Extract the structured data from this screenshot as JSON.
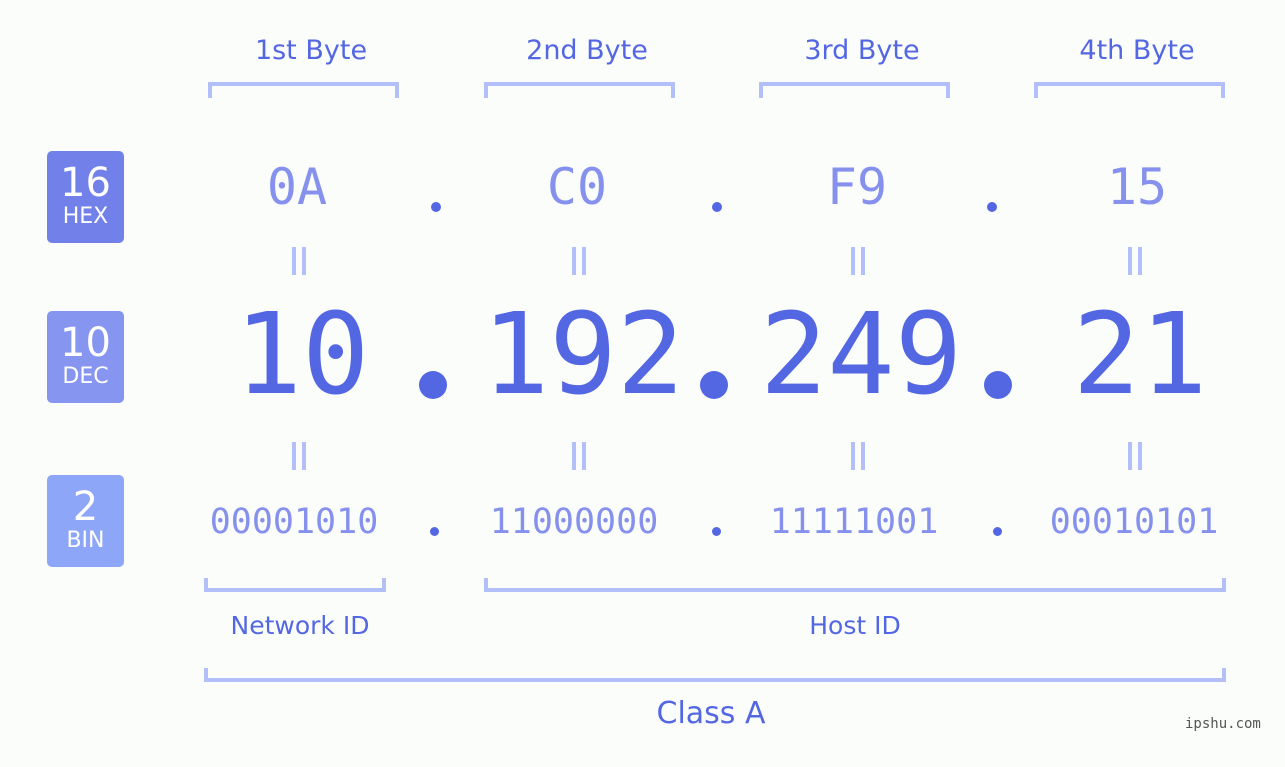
{
  "headers": [
    "1st Byte",
    "2nd Byte",
    "3rd Byte",
    "4th Byte"
  ],
  "badges": [
    {
      "num": "16",
      "label": "HEX",
      "color": "#7281ea"
    },
    {
      "num": "10",
      "label": "DEC",
      "color": "#8595f0"
    },
    {
      "num": "2",
      "label": "BIN",
      "color": "#8ea6f8"
    }
  ],
  "hex": [
    "0A",
    "C0",
    "F9",
    "15"
  ],
  "dec": [
    "10",
    "192",
    "249",
    "21"
  ],
  "bin": [
    "00001010",
    "11000000",
    "11111001",
    "00010101"
  ],
  "network_id_label": "Network ID",
  "host_id_label": "Host ID",
  "class_label": "Class A",
  "watermark": "ipshu.com",
  "colors": {
    "primary": "#5467e3",
    "secondary": "#8591ec",
    "bracket": "#b3bff8",
    "background": "#fbfdfb"
  }
}
